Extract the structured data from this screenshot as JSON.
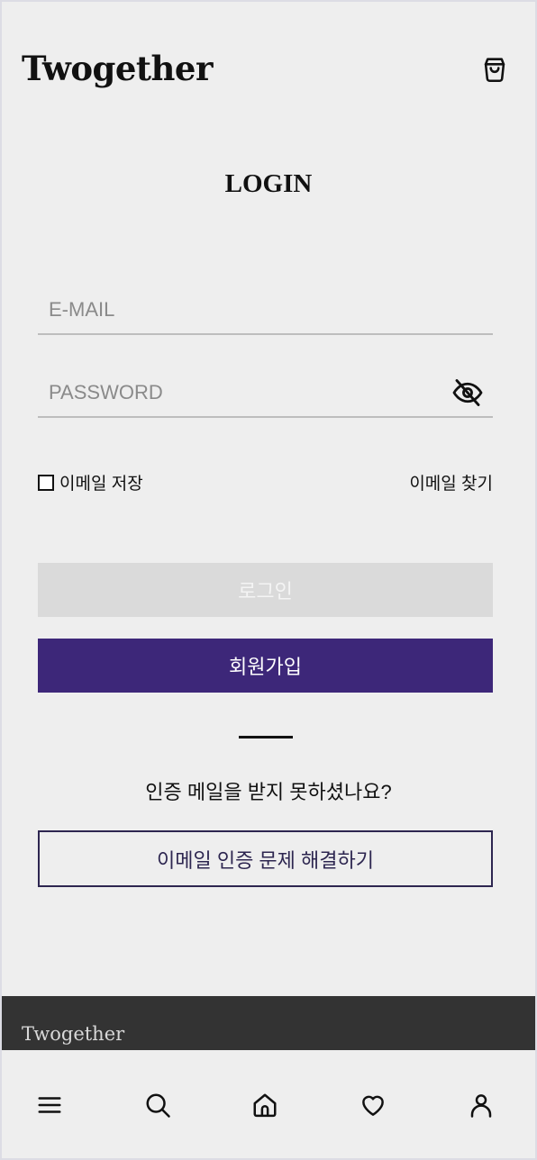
{
  "header": {
    "logo": "Twogether",
    "cart_icon": "shopping-bag-icon"
  },
  "page_title": "LOGIN",
  "form": {
    "email_placeholder": "E-MAIL",
    "email_value": "",
    "password_placeholder": "PASSWORD",
    "password_value": "",
    "password_toggle_icon": "eye-off-icon",
    "save_email_label": "이메일 저장",
    "save_email_checked": false,
    "find_email_label": "이메일 찾기",
    "login_label": "로그인",
    "signup_label": "회원가입"
  },
  "verification": {
    "question": "인증 메일을 받지 못하셨나요?",
    "resolve_label": "이메일 인증 문제 해결하기"
  },
  "footer": {
    "logo": "Twogether"
  },
  "tab_bar": {
    "items": [
      {
        "icon": "menu-icon"
      },
      {
        "icon": "search-icon"
      },
      {
        "icon": "home-icon"
      },
      {
        "icon": "heart-icon"
      },
      {
        "icon": "user-icon"
      }
    ]
  },
  "colors": {
    "background": "#eeeeee",
    "accent": "#3d2779",
    "disabled_button": "#dadada",
    "footer": "#333333"
  }
}
